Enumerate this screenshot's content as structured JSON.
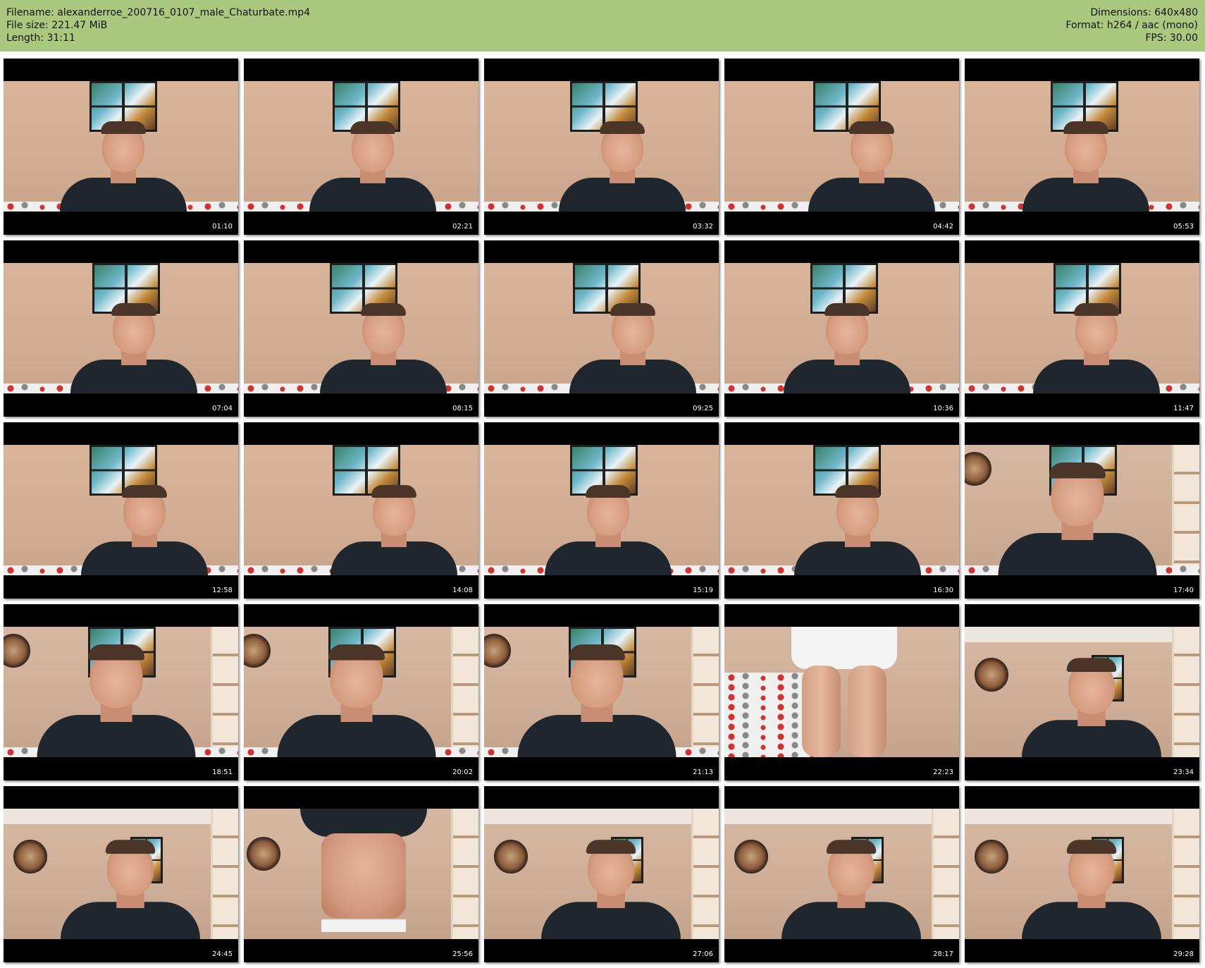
{
  "header": {
    "filename_label": "Filename: alexanderroe_200716_0107_male_Chaturbate.mp4",
    "filesize_label": "File size: 221.47 MiB",
    "length_label": "Length: 31:11",
    "dimensions_label": "Dimensions: 640x480",
    "format_label": "Format: h264 / aac (mono)",
    "fps_label": "FPS: 30.00",
    "background_color": "#abc97e"
  },
  "thumbnails": [
    {
      "timestamp": "01:10",
      "scene": "poster-room"
    },
    {
      "timestamp": "02:21",
      "scene": "poster-room"
    },
    {
      "timestamp": "03:32",
      "scene": "poster-room"
    },
    {
      "timestamp": "04:42",
      "scene": "poster-room"
    },
    {
      "timestamp": "05:53",
      "scene": "poster-room"
    },
    {
      "timestamp": "07:04",
      "scene": "poster-room"
    },
    {
      "timestamp": "08:15",
      "scene": "poster-room"
    },
    {
      "timestamp": "09:25",
      "scene": "poster-room"
    },
    {
      "timestamp": "10:36",
      "scene": "poster-room"
    },
    {
      "timestamp": "11:47",
      "scene": "poster-room"
    },
    {
      "timestamp": "12:58",
      "scene": "poster-room"
    },
    {
      "timestamp": "14:08",
      "scene": "poster-room"
    },
    {
      "timestamp": "15:19",
      "scene": "poster-room"
    },
    {
      "timestamp": "16:30",
      "scene": "poster-room"
    },
    {
      "timestamp": "17:40",
      "scene": "closeup-shelf"
    },
    {
      "timestamp": "18:51",
      "scene": "closeup-shelf"
    },
    {
      "timestamp": "20:02",
      "scene": "closeup-shelf"
    },
    {
      "timestamp": "21:13",
      "scene": "closeup-shelf"
    },
    {
      "timestamp": "22:23",
      "scene": "standing"
    },
    {
      "timestamp": "23:34",
      "scene": "wide-clock"
    },
    {
      "timestamp": "24:45",
      "scene": "wide-clock"
    },
    {
      "timestamp": "25:56",
      "scene": "torso"
    },
    {
      "timestamp": "27:06",
      "scene": "wide-clock"
    },
    {
      "timestamp": "28:17",
      "scene": "wide-clock"
    },
    {
      "timestamp": "29:28",
      "scene": "wide-clock"
    }
  ]
}
